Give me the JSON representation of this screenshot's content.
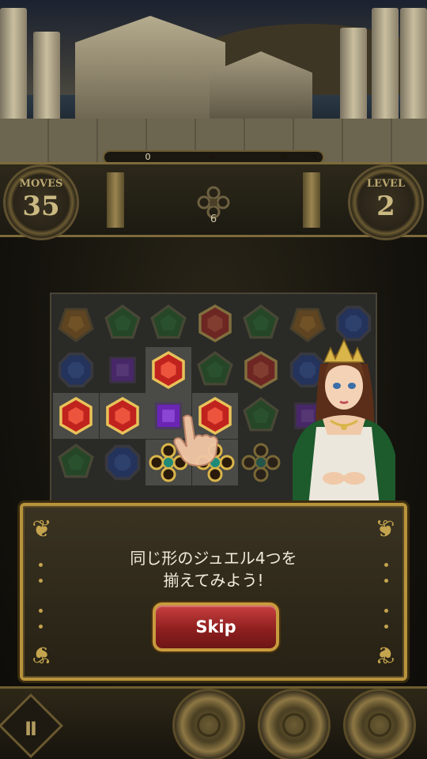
{
  "score": {
    "value": "0",
    "stars": [
      "★",
      "★",
      "★"
    ]
  },
  "hud": {
    "moves_label": "MOVES",
    "moves_value": "35",
    "level_label": "LEVEL",
    "level_value": "2",
    "goal_count": "6"
  },
  "board": {
    "rows": [
      [
        "amber-pentagon",
        "green-pentagon",
        "green-pentagon",
        "red-hexagon",
        "green-pentagon",
        "amber-pentagon",
        "blue-octagon"
      ],
      [
        "blue-octagon",
        "purple-square",
        "red-hexagon",
        "green-pentagon",
        "red-hexagon",
        "blue-octagon",
        "empty"
      ],
      [
        "red-hexagon",
        "red-hexagon",
        "purple-square",
        "red-hexagon",
        "green-pentagon",
        "purple-square",
        "empty"
      ],
      [
        "green-pentagon",
        "blue-octagon",
        "gold-amulet",
        "gold-amulet",
        "gold-amulet",
        "empty",
        "empty"
      ]
    ],
    "highlighted": [
      [
        1,
        2
      ],
      [
        2,
        0
      ],
      [
        2,
        1
      ],
      [
        2,
        2
      ],
      [
        2,
        3
      ],
      [
        3,
        2
      ],
      [
        3,
        3
      ]
    ]
  },
  "dialog": {
    "text": "同じ形のジュエル4つを\n揃えてみよう!",
    "skip_label": "Skip"
  },
  "colors": {
    "gold": "#b8933c",
    "red_gem": "#c0221e",
    "green_gem": "#1f6b2a",
    "blue_gem": "#1d3f9a",
    "purple_gem": "#6a25b5",
    "skip_button": "#9a2323"
  },
  "icons": {
    "pause": "Ⅱ",
    "laurel": "❦"
  }
}
